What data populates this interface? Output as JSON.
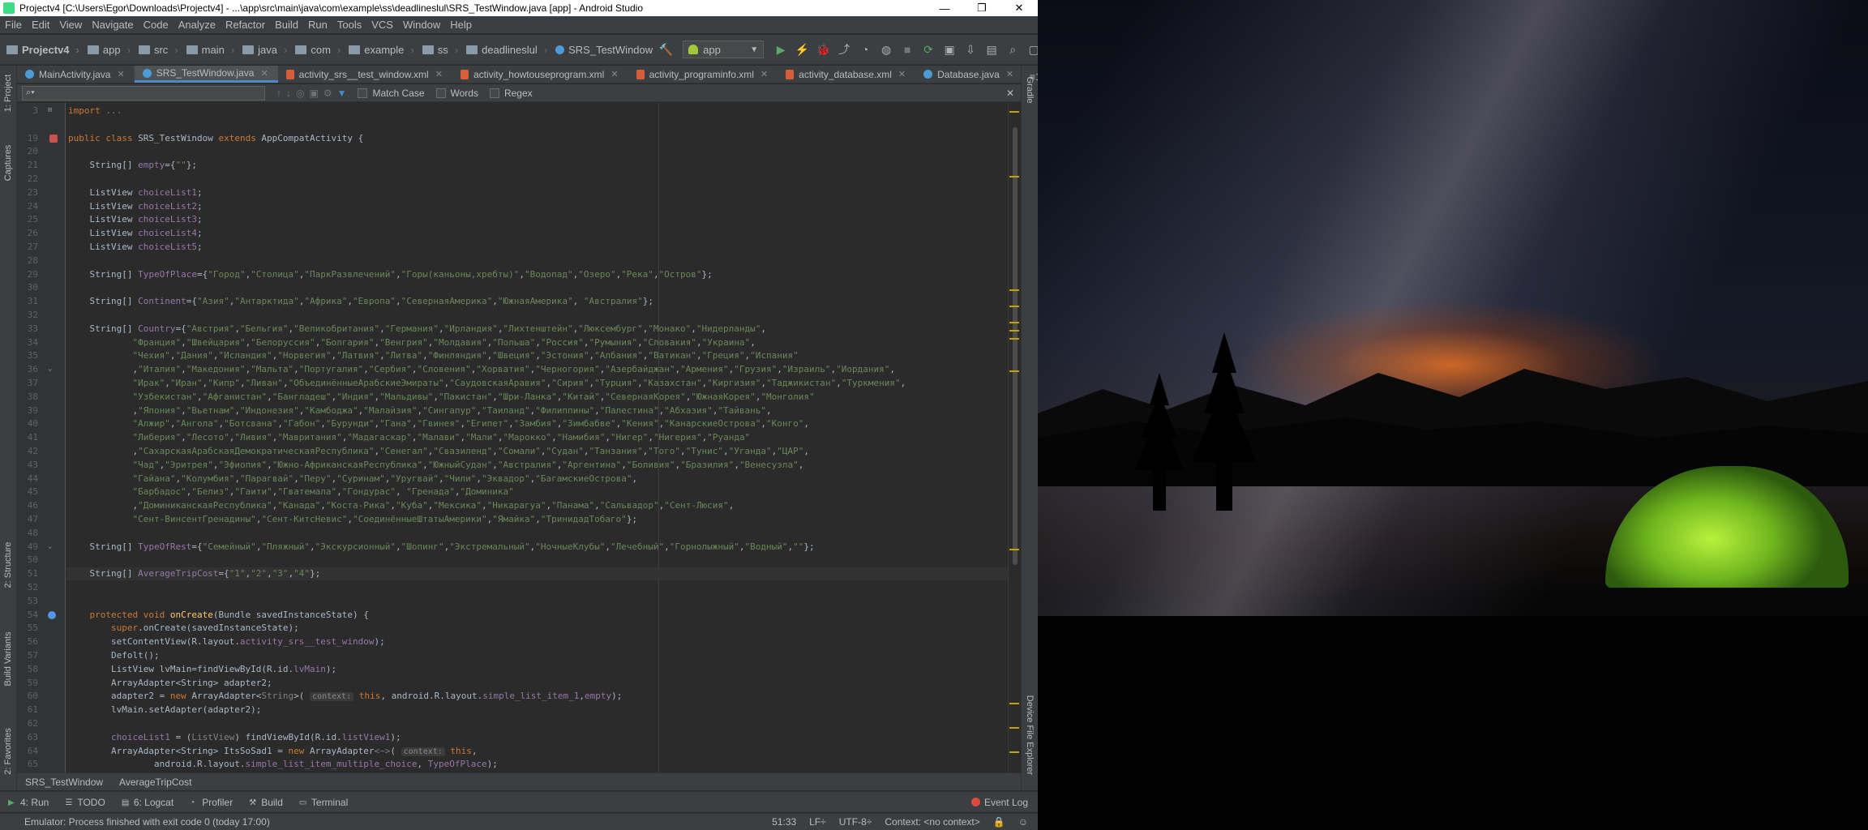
{
  "window": {
    "title": "Projectv4 [C:\\Users\\Egor\\Downloads\\Projectv4] - ...\\app\\src\\main\\java\\com\\example\\ss\\deadlineslul\\SRS_TestWindow.java [app] - Android Studio",
    "minimize": "—",
    "restore": "❐",
    "close": "✕"
  },
  "menu": [
    "File",
    "Edit",
    "View",
    "Navigate",
    "Code",
    "Analyze",
    "Refactor",
    "Build",
    "Run",
    "Tools",
    "VCS",
    "Window",
    "Help"
  ],
  "breadcrumbs": [
    "Projectv4",
    "app",
    "src",
    "main",
    "java",
    "com",
    "example",
    "ss",
    "deadlineslul",
    "SRS_TestWindow"
  ],
  "run_config": "app",
  "tabs": [
    {
      "label": "MainActivity.java",
      "type": "java",
      "active": false
    },
    {
      "label": "SRS_TestWindow.java",
      "type": "java",
      "active": true
    },
    {
      "label": "activity_srs__test_window.xml",
      "type": "xml",
      "active": false
    },
    {
      "label": "activity_howtouseprogram.xml",
      "type": "xml",
      "active": false
    },
    {
      "label": "activity_programinfo.xml",
      "type": "xml",
      "active": false
    },
    {
      "label": "activity_database.xml",
      "type": "xml",
      "active": false
    },
    {
      "label": "Database.java",
      "type": "java",
      "active": false
    }
  ],
  "tabs_overflow": "≡1",
  "search": {
    "placeholder": "",
    "match_case": "Match Case",
    "words": "Words",
    "regex": "Regex"
  },
  "left_tools": [
    "1: Project",
    "Captures",
    "2: Structure",
    "Build Variants",
    "2: Favorites"
  ],
  "right_tools": [
    "Gradle",
    "Device File Explorer"
  ],
  "code_lines": [
    {
      "n": "3",
      "html": "<span class=\"kw\">import</span> <span class=\"cm\">...</span>"
    },
    {
      "n": "",
      "html": ""
    },
    {
      "n": "19",
      "html": "<span class=\"kw\">public class</span> SRS_TestWindow <span class=\"kw\">extends</span> AppCompatActivity {"
    },
    {
      "n": "20",
      "html": ""
    },
    {
      "n": "21",
      "html": "    String[] <span class=\"fld\">empty</span>={<span class=\"str\">\"\"</span>};"
    },
    {
      "n": "22",
      "html": ""
    },
    {
      "n": "23",
      "html": "    ListView <span class=\"fld\">choiceList1</span>;"
    },
    {
      "n": "24",
      "html": "    ListView <span class=\"fld\">choiceList2</span>;"
    },
    {
      "n": "25",
      "html": "    ListView <span class=\"fld\">choiceList3</span>;"
    },
    {
      "n": "26",
      "html": "    ListView <span class=\"fld\">choiceList4</span>;"
    },
    {
      "n": "27",
      "html": "    ListView <span class=\"fld\">choiceList5</span>;"
    },
    {
      "n": "28",
      "html": ""
    },
    {
      "n": "29",
      "html": "    String[] <span class=\"fld\">TypeOfPlace</span>={<span class=\"str\">\"Город\"</span>,<span class=\"str\">\"Столица\"</span>,<span class=\"str\">\"ПаркРазвлечений\"</span>,<span class=\"str\">\"Горы(каньоны,хребты)\"</span>,<span class=\"str\">\"Водопад\"</span>,<span class=\"str\">\"Озеро\"</span>,<span class=\"str\">\"Река\"</span>,<span class=\"str\">\"Остров\"</span>};"
    },
    {
      "n": "30",
      "html": ""
    },
    {
      "n": "31",
      "html": "    String[] <span class=\"fld\">Continent</span>={<span class=\"str\">\"Азия\"</span>,<span class=\"str\">\"Антарктида\"</span>,<span class=\"str\">\"Африка\"</span>,<span class=\"str\">\"Европа\"</span>,<span class=\"str\">\"СевернаяАмерика\"</span>,<span class=\"str\">\"ЮжнаяАмерика\"</span>, <span class=\"str\">\"Австралия\"</span>};"
    },
    {
      "n": "32",
      "html": ""
    },
    {
      "n": "33",
      "html": "    String[] <span class=\"fld\">Country</span>={<span class=\"str\">\"Австрия\"</span>,<span class=\"str\">\"Бельгия\"</span>,<span class=\"str\">\"Великобритания\"</span>,<span class=\"str\">\"Германия\"</span>,<span class=\"str\">\"Ирландия\"</span>,<span class=\"str\">\"Лихтенштейн\"</span>,<span class=\"str\">\"Люксембург\"</span>,<span class=\"str\">\"Монако\"</span>,<span class=\"str\">\"Нидерланды\"</span>,"
    },
    {
      "n": "34",
      "html": "            <span class=\"str\">\"Франция\"</span>,<span class=\"str\">\"Швейцария\"</span>,<span class=\"str\">\"Белоруссия\"</span>,<span class=\"str\">\"Болгария\"</span>,<span class=\"str\">\"Венгрия\"</span>,<span class=\"str\">\"Молдавия\"</span>,<span class=\"str\">\"Польша\"</span>,<span class=\"str\">\"Россия\"</span>,<span class=\"str\">\"Румыния\"</span>,<span class=\"str\">\"Словакия\"</span>,<span class=\"str\">\"Украина\"</span>,"
    },
    {
      "n": "35",
      "html": "            <span class=\"str\">\"Чехия\"</span>,<span class=\"str\">\"Дания\"</span>,<span class=\"str\">\"Исландия\"</span>,<span class=\"str\">\"Норвегия\"</span>,<span class=\"str\">\"Латвия\"</span>,<span class=\"str\">\"Литва\"</span>,<span class=\"str\">\"Финляндия\"</span>,<span class=\"str\">\"Швеция\"</span>,<span class=\"str\">\"Эстония\"</span>,<span class=\"str\">\"Албания\"</span>,<span class=\"str\">\"Ватикан\"</span>,<span class=\"str\">\"Греция\"</span>,<span class=\"str\">\"Испания\"</span>"
    },
    {
      "n": "36",
      "html": "            ,<span class=\"str\">\"Италия\"</span>,<span class=\"str\">\"Македония\"</span>,<span class=\"str\">\"Мальта\"</span>,<span class=\"str\">\"Португалия\"</span>,<span class=\"str\">\"Сербия\"</span>,<span class=\"str\">\"Словения\"</span>,<span class=\"str\">\"Хорватия\"</span>,<span class=\"str\">\"Черногория\"</span>,<span class=\"str\">\"Азербайджан\"</span>,<span class=\"str\">\"Армения\"</span>,<span class=\"str\">\"Грузия\"</span>,<span class=\"str\">\"Израиль\"</span>,<span class=\"str\">\"Иордания\"</span>,"
    },
    {
      "n": "37",
      "html": "            <span class=\"str\">\"Ирак\"</span>,<span class=\"str\">\"Иран\"</span>,<span class=\"str\">\"Кипр\"</span>,<span class=\"str\">\"Ливан\"</span>,<span class=\"str\">\"ОбъединённыеАрабскиеЭмираты\"</span>,<span class=\"str\">\"СаудовскаяАравия\"</span>,<span class=\"str\">\"Сирия\"</span>,<span class=\"str\">\"Турция\"</span>,<span class=\"str\">\"Казахстан\"</span>,<span class=\"str\">\"Киргизия\"</span>,<span class=\"str\">\"Таджикистан\"</span>,<span class=\"str\">\"Туркмения\"</span>,"
    },
    {
      "n": "38",
      "html": "            <span class=\"str\">\"Узбекистан\"</span>,<span class=\"str\">\"Афганистан\"</span>,<span class=\"str\">\"Бангладеш\"</span>,<span class=\"str\">\"Индия\"</span>,<span class=\"str\">\"Мальдивы\"</span>,<span class=\"str\">\"Пакистан\"</span>,<span class=\"str\">\"Шри-Ланка\"</span>,<span class=\"str\">\"Китай\"</span>,<span class=\"str\">\"СевернаяКорея\"</span>,<span class=\"str\">\"ЮжнаяКорея\"</span>,<span class=\"str\">\"Монголия\"</span>"
    },
    {
      "n": "39",
      "html": "            ,<span class=\"str\">\"Япония\"</span>,<span class=\"str\">\"Вьетнам\"</span>,<span class=\"str\">\"Индонезия\"</span>,<span class=\"str\">\"Камбоджа\"</span>,<span class=\"str\">\"Малайзия\"</span>,<span class=\"str\">\"Сингапур\"</span>,<span class=\"str\">\"Таиланд\"</span>,<span class=\"str\">\"Филиппины\"</span>,<span class=\"str\">\"Палестина\"</span>,<span class=\"str\">\"Абхазия\"</span>,<span class=\"str\">\"Тайвань\"</span>,"
    },
    {
      "n": "40",
      "html": "            <span class=\"str\">\"Алжир\"</span>,<span class=\"str\">\"Ангола\"</span>,<span class=\"str\">\"Ботсвана\"</span>,<span class=\"str\">\"Габон\"</span>,<span class=\"str\">\"Бурунди\"</span>,<span class=\"str\">\"Гана\"</span>,<span class=\"str\">\"Гвинея\"</span>,<span class=\"str\">\"Египет\"</span>,<span class=\"str\">\"Замбия\"</span>,<span class=\"str\">\"Зимбабве\"</span>,<span class=\"str\">\"Кения\"</span>,<span class=\"str\">\"КанарскиеОстрова\"</span>,<span class=\"str\">\"Конго\"</span>,"
    },
    {
      "n": "41",
      "html": "            <span class=\"str\">\"Либерия\"</span>,<span class=\"str\">\"Лесото\"</span>,<span class=\"str\">\"Ливия\"</span>,<span class=\"str\">\"Мавритания\"</span>,<span class=\"str\">\"Мадагаскар\"</span>,<span class=\"str\">\"Малави\"</span>,<span class=\"str\">\"Мали\"</span>,<span class=\"str\">\"Марокко\"</span>,<span class=\"str\">\"Намибия\"</span>,<span class=\"str\">\"Нигер\"</span>,<span class=\"str\">\"Нигерия\"</span>,<span class=\"str\">\"Руанда\"</span>"
    },
    {
      "n": "42",
      "html": "            ,<span class=\"str\">\"СахарскаяАрабскаяДемократическаяРеспублика\"</span>,<span class=\"str\">\"Сенегал\"</span>,<span class=\"str\">\"Свазиленд\"</span>,<span class=\"str\">\"Сомали\"</span>,<span class=\"str\">\"Судан\"</span>,<span class=\"str\">\"Танзания\"</span>,<span class=\"str\">\"Того\"</span>,<span class=\"str\">\"Тунис\"</span>,<span class=\"str\">\"Уганда\"</span>,<span class=\"str\">\"ЦАР\"</span>,"
    },
    {
      "n": "43",
      "html": "            <span class=\"str\">\"Чад\"</span>,<span class=\"str\">\"Эритрея\"</span>,<span class=\"str\">\"Эфиопия\"</span>,<span class=\"str\">\"Южно-АфриканскаяРеспублика\"</span>,<span class=\"str\">\"ЮжныйСудан\"</span>,<span class=\"str\">\"Австралия\"</span>,<span class=\"str\">\"Аргентина\"</span>,<span class=\"str\">\"Боливия\"</span>,<span class=\"str\">\"Бразилия\"</span>,<span class=\"str\">\"Венесуэла\"</span>,"
    },
    {
      "n": "44",
      "html": "            <span class=\"str\">\"Гайана\"</span>,<span class=\"str\">\"Колумбия\"</span>,<span class=\"str\">\"Парагвай\"</span>,<span class=\"str\">\"Перу\"</span>,<span class=\"str\">\"Суринам\"</span>,<span class=\"str\">\"Уругвай\"</span>,<span class=\"str\">\"Чили\"</span>,<span class=\"str\">\"Эквадор\"</span>,<span class=\"str\">\"БагамскиеОстрова\"</span>,"
    },
    {
      "n": "45",
      "html": "            <span class=\"str\">\"Барбадос\"</span>,<span class=\"str\">\"Белиз\"</span>,<span class=\"str\">\"Гаити\"</span>,<span class=\"str\">\"Гватемала\"</span>,<span class=\"str\">\"Гондурас\"</span>, <span class=\"str\">\"Гренада\"</span>,<span class=\"str\">\"Доминика\"</span>"
    },
    {
      "n": "46",
      "html": "            ,<span class=\"str\">\"ДоминиканскаяРеспублика\"</span>,<span class=\"str\">\"Канада\"</span>,<span class=\"str\">\"Коста-Рика\"</span>,<span class=\"str\">\"Куба\"</span>,<span class=\"str\">\"Мексика\"</span>,<span class=\"str\">\"Никарагуа\"</span>,<span class=\"str\">\"Панама\"</span>,<span class=\"str\">\"Сальвадор\"</span>,<span class=\"str\">\"Сент-Люсия\"</span>,"
    },
    {
      "n": "47",
      "html": "            <span class=\"str\">\"Сент-ВинсентГренадины\"</span>,<span class=\"str\">\"Сент-КитсНевис\"</span>,<span class=\"str\">\"СоединённыеШтатыАмерики\"</span>,<span class=\"str\">\"Ямайка\"</span>,<span class=\"str\">\"ТринидадТобаго\"</span>};"
    },
    {
      "n": "48",
      "html": ""
    },
    {
      "n": "49",
      "html": "    String[] <span class=\"fld\">TypeOfRest</span>={<span class=\"str\">\"Семейный\"</span>,<span class=\"str\">\"Пляжный\"</span>,<span class=\"str\">\"Экскурсионный\"</span>,<span class=\"str\">\"Шопинг\"</span>,<span class=\"str\">\"Экстремальный\"</span>,<span class=\"str\">\"НочныеКлубы\"</span>,<span class=\"str\">\"Лечебный\"</span>,<span class=\"str\">\"Горнолыжный\"</span>,<span class=\"str\">\"Водный\"</span>,<span class=\"str\">\"\"</span>};"
    },
    {
      "n": "50",
      "html": ""
    },
    {
      "n": "51",
      "html": "    String[] <span class=\"fld\">AverageTripCost</span>={<span class=\"str\">\"1\"</span>,<span class=\"str\">\"2\"</span>,<span class=\"str\">\"3\"</span>,<span class=\"str\">\"4\"</span>};"
    },
    {
      "n": "52",
      "html": ""
    },
    {
      "n": "53",
      "html": ""
    },
    {
      "n": "54",
      "html": "    <span class=\"kw\">protected void</span> <span class=\"fn\">onCreate</span>(Bundle savedInstanceState) {"
    },
    {
      "n": "55",
      "html": "        <span class=\"kw\">super</span>.onCreate(savedInstanceState);"
    },
    {
      "n": "56",
      "html": "        setContentView(R.layout.<span class=\"fld\">activity_srs__test_window</span>);"
    },
    {
      "n": "57",
      "html": "        Defolt();"
    },
    {
      "n": "58",
      "html": "        ListView lvMain=findViewById(R.id.<span class=\"fld\">lvMain</span>);"
    },
    {
      "n": "59",
      "html": "        ArrayAdapter&lt;String&gt; adapter2;"
    },
    {
      "n": "60",
      "html": "        adapter2 = <span class=\"kw\">new</span> ArrayAdapter&lt;<span class=\"cm\">String</span>&gt;( <span class=\"hint\">context:</span> <span class=\"kw\">this</span>, android.R.layout.<span class=\"fld\">simple_list_item_1</span>,<span class=\"fld\">empty</span>);"
    },
    {
      "n": "61",
      "html": "        lvMain.setAdapter(adapter2);"
    },
    {
      "n": "62",
      "html": ""
    },
    {
      "n": "63",
      "html": "        <span class=\"fld\">choiceList1</span> = (<span class=\"cm\">ListView</span>) findViewById(R.id.<span class=\"fld\">listView1</span>);"
    },
    {
      "n": "64",
      "html": "        ArrayAdapter&lt;String&gt; ItsSoSad1 = <span class=\"kw\">new</span> ArrayAdapter<span class=\"cm\">&lt;~&gt;</span>( <span class=\"hint\">context:</span> <span class=\"kw\">this</span>,"
    },
    {
      "n": "65",
      "html": "                android.R.layout.<span class=\"fld\">simple_list_item_multiple_choice</span>, <span class=\"fld\">TypeOfPlace</span>);"
    }
  ],
  "editor_breadcrumbs": [
    "SRS_TestWindow",
    "AverageTripCost"
  ],
  "bottom_tools": [
    "4: Run",
    "TODO",
    "6: Logcat",
    "Profiler",
    "Build",
    "Terminal"
  ],
  "event_log": "Event Log",
  "status": {
    "message": "Emulator: Process finished with exit code 0 (today 17:00)",
    "position": "51:33",
    "line_sep": "LF÷",
    "encoding": "UTF-8÷",
    "context": "Context: <no context>"
  }
}
